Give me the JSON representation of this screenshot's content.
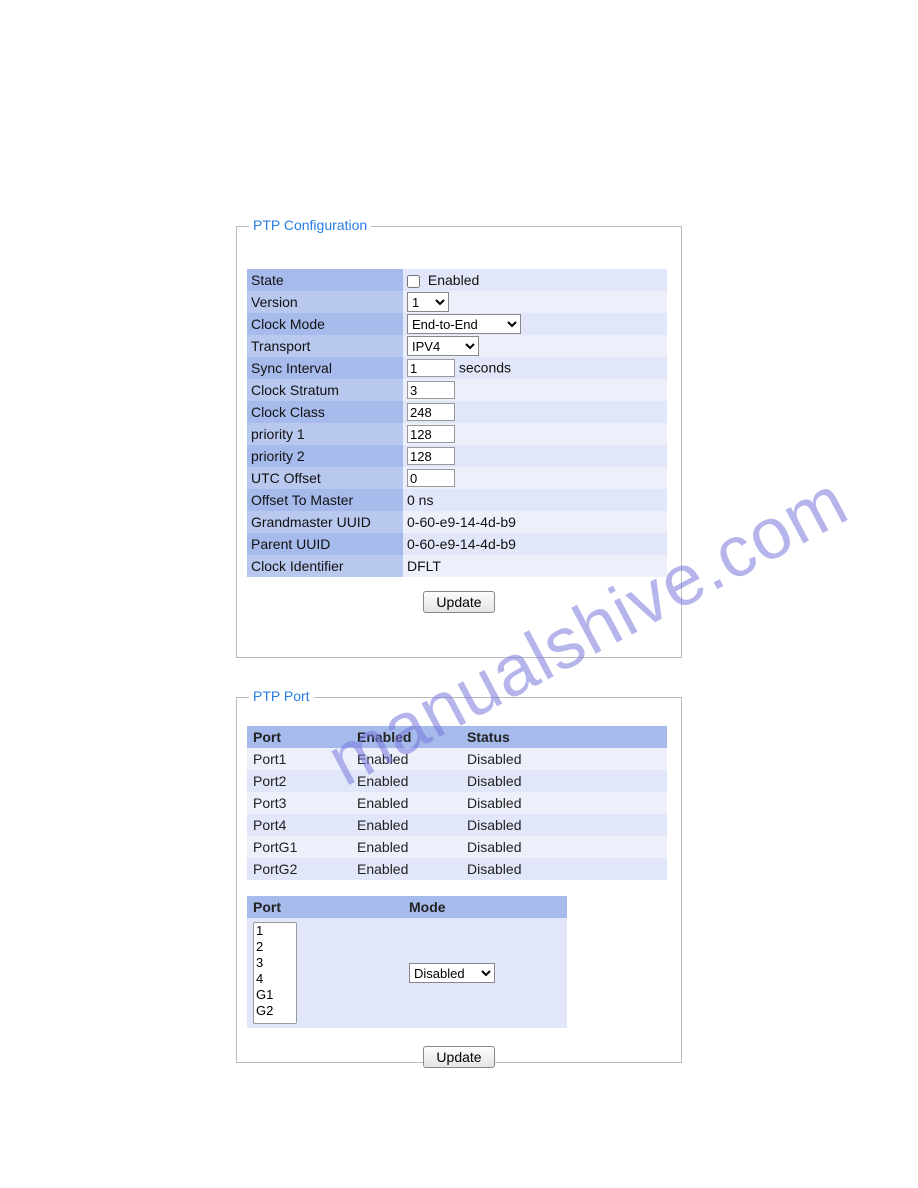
{
  "watermark": "manualshive.com",
  "config": {
    "legend": "PTP Configuration",
    "rows": {
      "state": {
        "label": "State",
        "enabled_text": "Enabled",
        "checked": false
      },
      "version": {
        "label": "Version",
        "value": "1"
      },
      "clockmode": {
        "label": "Clock Mode",
        "value": "End-to-End"
      },
      "transport": {
        "label": "Transport",
        "value": "IPV4"
      },
      "sync": {
        "label": "Sync Interval",
        "value": "1",
        "suffix": "seconds"
      },
      "stratum": {
        "label": "Clock Stratum",
        "value": "3"
      },
      "class": {
        "label": "Clock Class",
        "value": "248"
      },
      "p1": {
        "label": "priority 1",
        "value": "128"
      },
      "p2": {
        "label": "priority 2",
        "value": "128"
      },
      "utc": {
        "label": "UTC Offset",
        "value": "0"
      },
      "offset": {
        "label": "Offset To Master",
        "value": "0 ns"
      },
      "gm": {
        "label": "Grandmaster UUID",
        "value": "0-60-e9-14-4d-b9"
      },
      "parent": {
        "label": "Parent UUID",
        "value": "0-60-e9-14-4d-b9"
      },
      "cid": {
        "label": "Clock Identifier",
        "value": "DFLT"
      }
    },
    "update_label": "Update"
  },
  "portpanel": {
    "legend": "PTP Port",
    "headers": {
      "port": "Port",
      "enabled": "Enabled",
      "status": "Status"
    },
    "rows": [
      {
        "port": "Port1",
        "enabled": "Enabled",
        "status": "Disabled"
      },
      {
        "port": "Port2",
        "enabled": "Enabled",
        "status": "Disabled"
      },
      {
        "port": "Port3",
        "enabled": "Enabled",
        "status": "Disabled"
      },
      {
        "port": "Port4",
        "enabled": "Enabled",
        "status": "Disabled"
      },
      {
        "port": "PortG1",
        "enabled": "Enabled",
        "status": "Disabled"
      },
      {
        "port": "PortG2",
        "enabled": "Enabled",
        "status": "Disabled"
      }
    ],
    "portmode": {
      "port_header": "Port",
      "mode_header": "Mode",
      "options": [
        "1",
        "2",
        "3",
        "4",
        "G1",
        "G2"
      ],
      "mode_value": "Disabled"
    },
    "update_label": "Update"
  }
}
